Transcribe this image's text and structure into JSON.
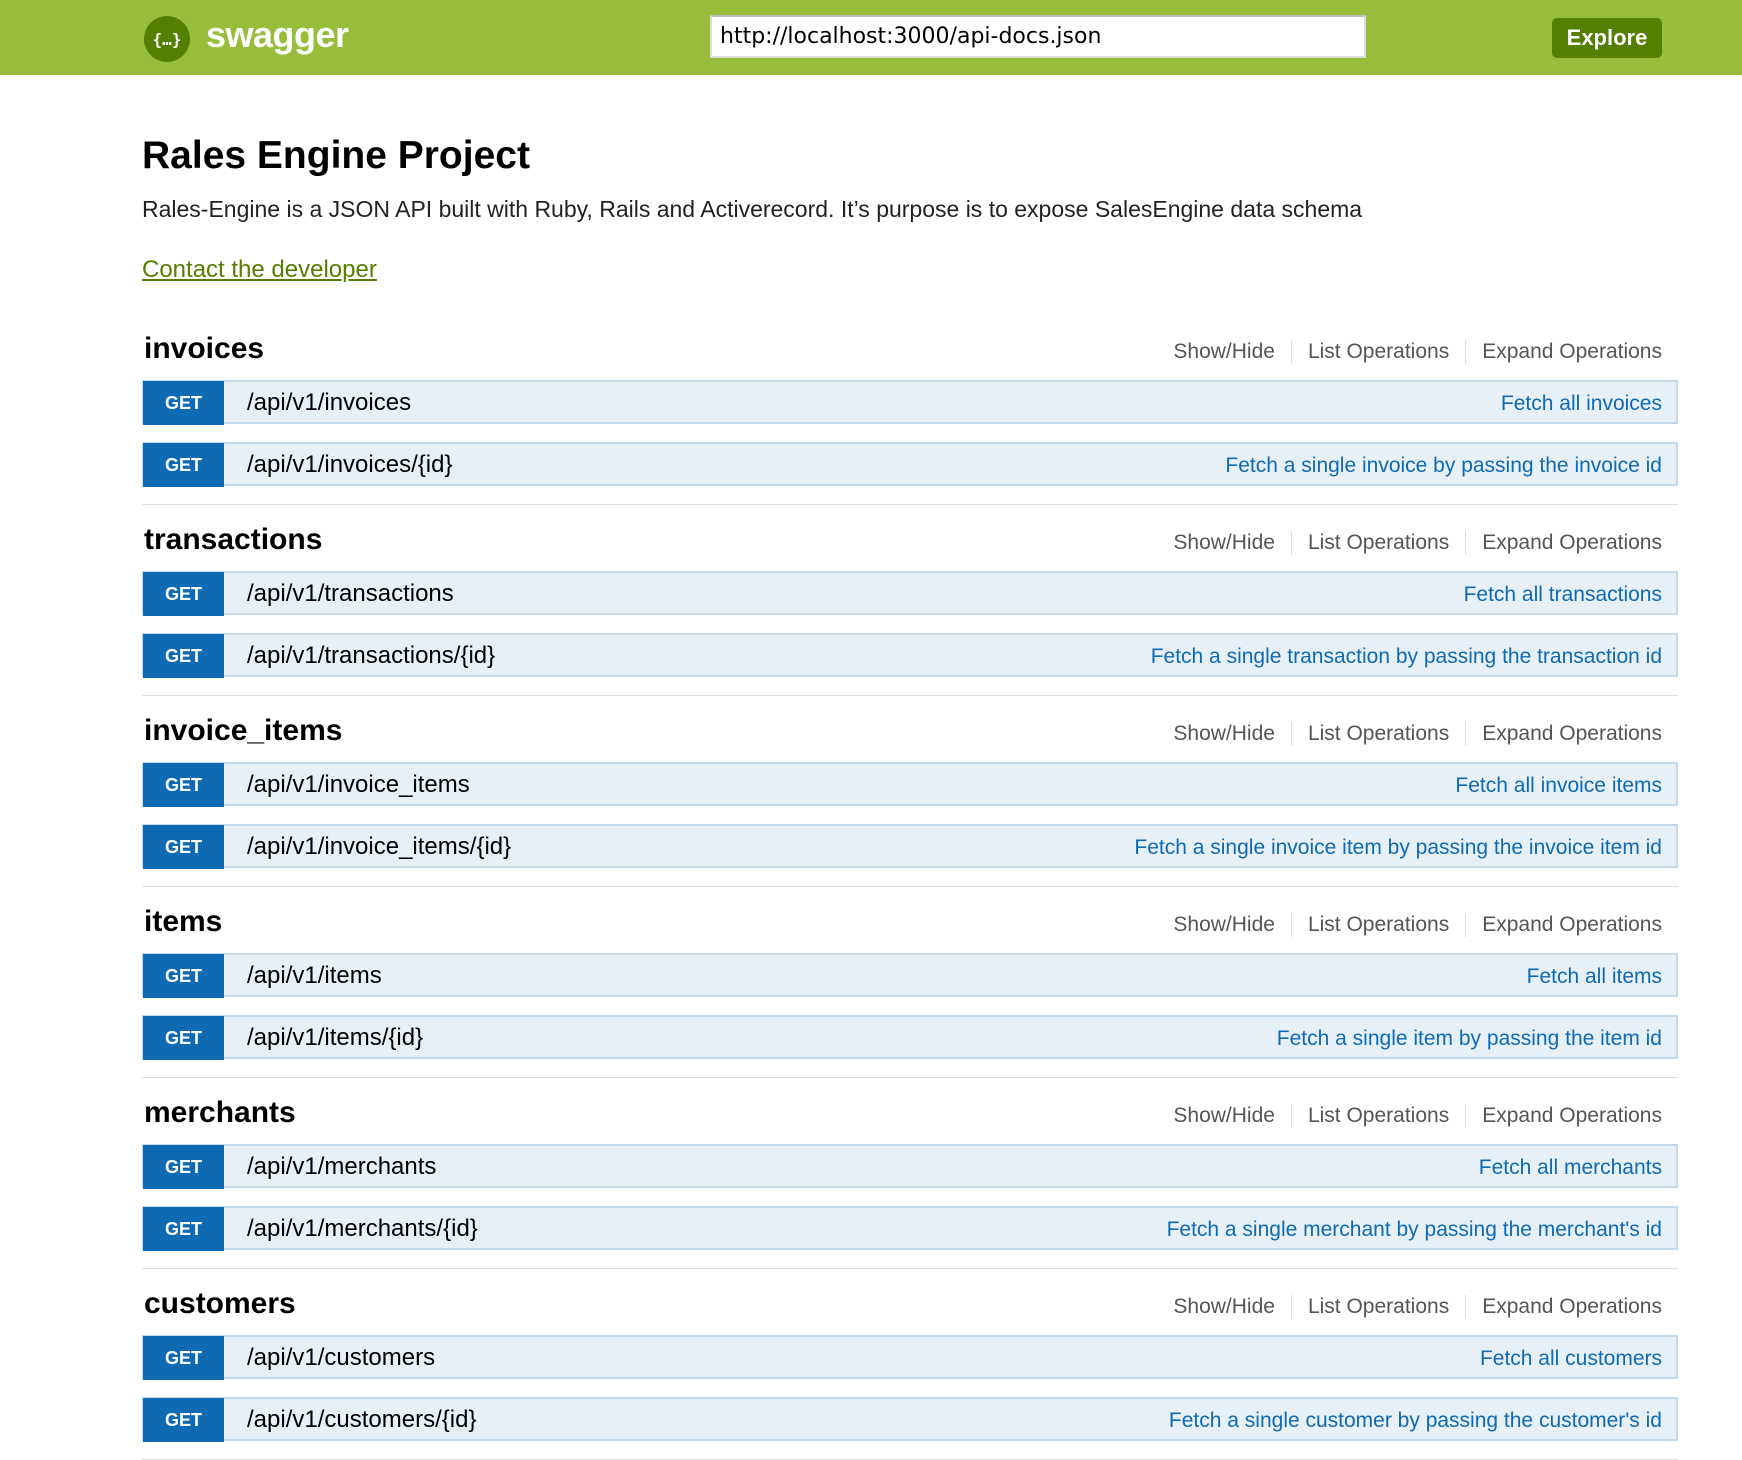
{
  "header": {
    "logo_glyph": "{…}",
    "logo_text": "swagger",
    "url_value": "http://localhost:3000/api-docs.json",
    "explore_label": "Explore",
    "color": "#97bd3b"
  },
  "info": {
    "title": "Rales Engine Project",
    "description": "Rales-Engine is a JSON API built with Ruby, Rails and Activerecord. It’s purpose is to expose SalesEngine data schema",
    "contact": "Contact the developer"
  },
  "ops_labels": {
    "show_hide": "Show/Hide",
    "list": "List Operations",
    "expand": "Expand Operations"
  },
  "sections": [
    {
      "name": "invoices",
      "ops": [
        {
          "method": "GET",
          "path": "/api/v1/invoices",
          "summary": "Fetch all invoices"
        },
        {
          "method": "GET",
          "path": "/api/v1/invoices/{id}",
          "summary": "Fetch a single invoice by passing the invoice id"
        }
      ]
    },
    {
      "name": "transactions",
      "ops": [
        {
          "method": "GET",
          "path": "/api/v1/transactions",
          "summary": "Fetch all transactions"
        },
        {
          "method": "GET",
          "path": "/api/v1/transactions/{id}",
          "summary": "Fetch a single transaction by passing the transaction id"
        }
      ]
    },
    {
      "name": "invoice_items",
      "ops": [
        {
          "method": "GET",
          "path": "/api/v1/invoice_items",
          "summary": "Fetch all invoice items"
        },
        {
          "method": "GET",
          "path": "/api/v1/invoice_items/{id}",
          "summary": "Fetch a single invoice item by passing the invoice item id"
        }
      ]
    },
    {
      "name": "items",
      "ops": [
        {
          "method": "GET",
          "path": "/api/v1/items",
          "summary": "Fetch all items"
        },
        {
          "method": "GET",
          "path": "/api/v1/items/{id}",
          "summary": "Fetch a single item by passing the item id"
        }
      ]
    },
    {
      "name": "merchants",
      "ops": [
        {
          "method": "GET",
          "path": "/api/v1/merchants",
          "summary": "Fetch all merchants"
        },
        {
          "method": "GET",
          "path": "/api/v1/merchants/{id}",
          "summary": "Fetch a single merchant by passing the merchant's id"
        }
      ]
    },
    {
      "name": "customers",
      "ops": [
        {
          "method": "GET",
          "path": "/api/v1/customers",
          "summary": "Fetch all customers"
        },
        {
          "method": "GET",
          "path": "/api/v1/customers/{id}",
          "summary": "Fetch a single customer by passing the customer's id"
        }
      ]
    }
  ]
}
